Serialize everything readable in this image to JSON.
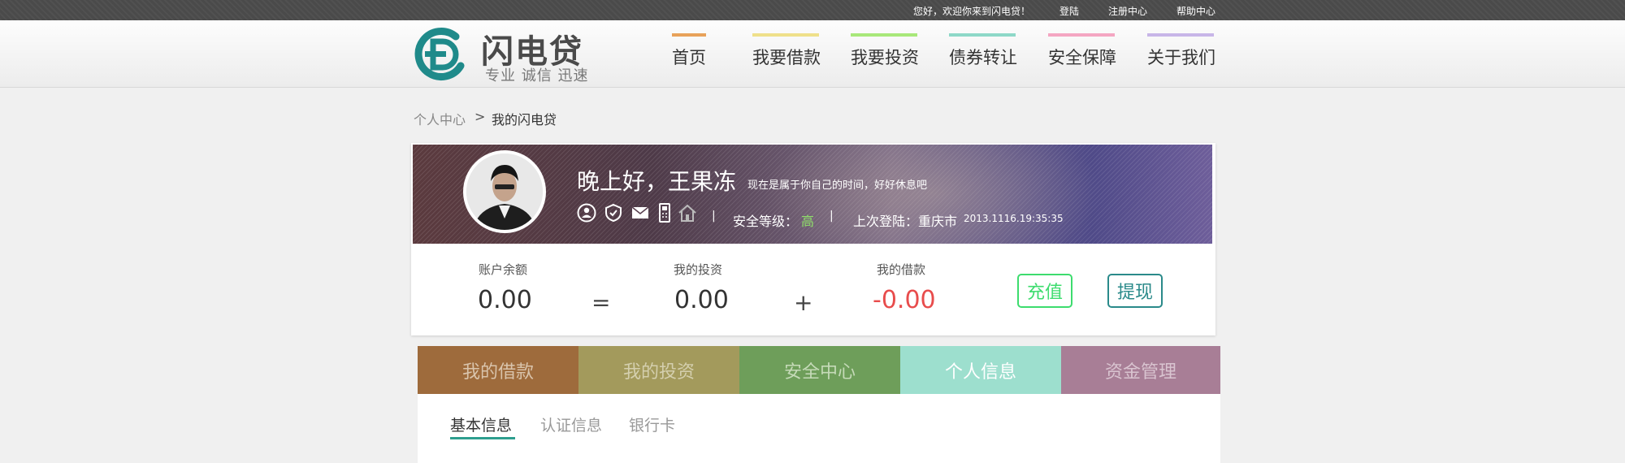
{
  "topbar": {
    "welcome": "您好，欢迎你来到闪电贷！",
    "login": "登陆",
    "register": "注册中心",
    "help": "帮助中心"
  },
  "brand": {
    "name": "闪电贷",
    "slogan": "专业 诚信 迅速",
    "logo_color": "#1f8a8a"
  },
  "nav": [
    {
      "label": "首页",
      "color": "#e8a25a"
    },
    {
      "label": "我要借款",
      "color": "#efe08a"
    },
    {
      "label": "我要投资",
      "color": "#a8e87a"
    },
    {
      "label": "债券转让",
      "color": "#8ed8c8"
    },
    {
      "label": "安全保障",
      "color": "#f4a6c2"
    },
    {
      "label": "关于我们",
      "color": "#c8b6e8"
    }
  ],
  "breadcrumb": {
    "root": "个人中心",
    "separator": ">",
    "current": "我的闪电贷"
  },
  "profile": {
    "greeting": "晚上好，王果冻",
    "greeting_sub": "现在是属于你自己的时间，好好休息吧",
    "security_icons": [
      "user-icon",
      "shield-icon",
      "mail-icon",
      "phone-icon",
      "home-icon"
    ],
    "security_label": "安全等级：",
    "security_level": "高",
    "last_login_label": "上次登陆：重庆市",
    "last_login_time": "2013.1116.19:35:35"
  },
  "account": {
    "balance_label": "账户余额",
    "balance": "0.00",
    "equals": "=",
    "invest_label": "我的投资",
    "invest": "0.00",
    "plus": "+",
    "loan_label": "我的借款",
    "loan": "-0.00",
    "recharge": "充值",
    "withdraw": "提现",
    "loan_color": "#e84c4c",
    "recharge_color": "#3ddc6e",
    "withdraw_color": "#2a8a8a"
  },
  "tabs": [
    {
      "label": "我的借款",
      "bg": "#9e6b3c",
      "fg": "#d9c4ac"
    },
    {
      "label": "我的投资",
      "bg": "#a39a5c",
      "fg": "#d4cfae"
    },
    {
      "label": "安全中心",
      "bg": "#6e9e5a",
      "fg": "#c5dab8"
    },
    {
      "label": "个人信息",
      "bg": "#9ddfce",
      "fg": "#ffffff"
    },
    {
      "label": "资金管理",
      "bg": "#a87e96",
      "fg": "#d9c4d0"
    }
  ],
  "subtabs": [
    {
      "label": "基本信息",
      "active": true
    },
    {
      "label": "认证信息",
      "active": false
    },
    {
      "label": "银行卡",
      "active": false
    }
  ]
}
